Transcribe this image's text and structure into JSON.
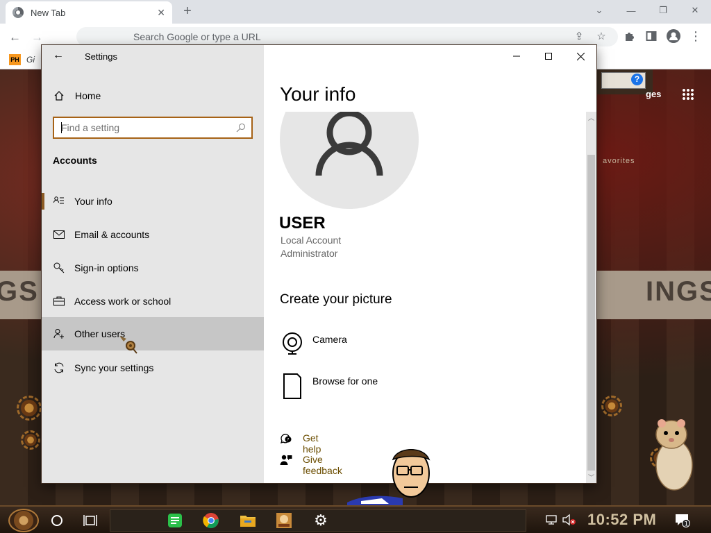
{
  "browser": {
    "tab_title": "New Tab",
    "omnibox_placeholder": "Search Google or type a URL",
    "bookmark_badge": "PH",
    "bookmark_label": "Gi"
  },
  "background_page": {
    "favorites_text": "avorites",
    "ages_text": "ges",
    "banner_left": "GS",
    "banner_right": "INGS"
  },
  "settings": {
    "app_title": "Settings",
    "home_label": "Home",
    "search": {
      "placeholder": "Find a setting",
      "value": ""
    },
    "section_title": "Accounts",
    "nav_items": [
      {
        "label": "Your info",
        "icon": "contact-card-icon"
      },
      {
        "label": "Email & accounts",
        "icon": "mail-icon"
      },
      {
        "label": "Sign-in options",
        "icon": "key-icon"
      },
      {
        "label": "Access work or school",
        "icon": "briefcase-icon"
      },
      {
        "label": "Other users",
        "icon": "add-person-icon"
      },
      {
        "label": "Sync your settings",
        "icon": "sync-icon"
      }
    ],
    "selected_nav": "Your info",
    "hovered_nav": "Other users"
  },
  "main": {
    "page_title": "Your info",
    "user_name": "USER",
    "account_type": "Local Account",
    "role": "Administrator",
    "create_picture_title": "Create your picture",
    "options": [
      {
        "label": "Camera",
        "icon": "camera-icon"
      },
      {
        "label": "Browse for one",
        "icon": "document-icon"
      }
    ],
    "links": [
      {
        "label": "Get help",
        "icon": "help-chat-icon"
      },
      {
        "label": "Give feedback",
        "icon": "feedback-icon"
      }
    ]
  },
  "taskbar": {
    "clock": "10:52 PM",
    "notification_count": "1"
  },
  "colors": {
    "accent": "#a66216",
    "link": "#6b4d00",
    "sidebar_bg": "#e6e6e6",
    "hover_bg": "#c6c6c6"
  }
}
